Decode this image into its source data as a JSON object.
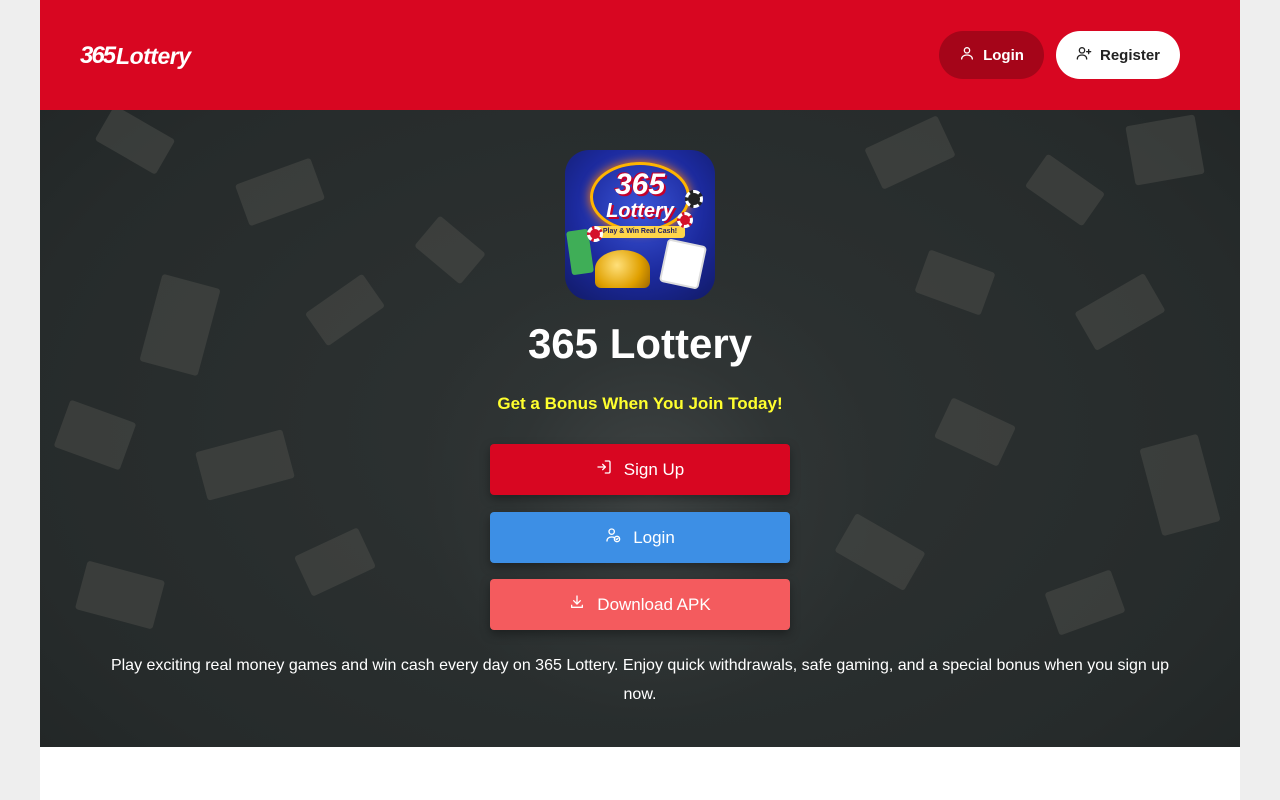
{
  "header": {
    "logo_number": "365",
    "logo_word": "Lottery",
    "login_label": "Login",
    "register_label": "Register",
    "brand_color": "#d80621"
  },
  "hero": {
    "app_icon": {
      "number": "365",
      "word": "Lottery",
      "banner": "Play & Win Real Cash!"
    },
    "title": "365 Lottery",
    "subtitle": "Get a Bonus When You Join Today!",
    "buttons": [
      {
        "label": "Sign Up",
        "icon": "sign-in-icon",
        "color": "#d80621"
      },
      {
        "label": "Login",
        "icon": "user-check-icon",
        "color": "#3d8fe5"
      },
      {
        "label": "Download APK",
        "icon": "download-icon",
        "color": "#f45b5e"
      }
    ],
    "description": "Play exciting real money games and win cash every day on 365 Lottery. Enjoy quick withdrawals, safe gaming, and a special bonus when you sign up now."
  }
}
